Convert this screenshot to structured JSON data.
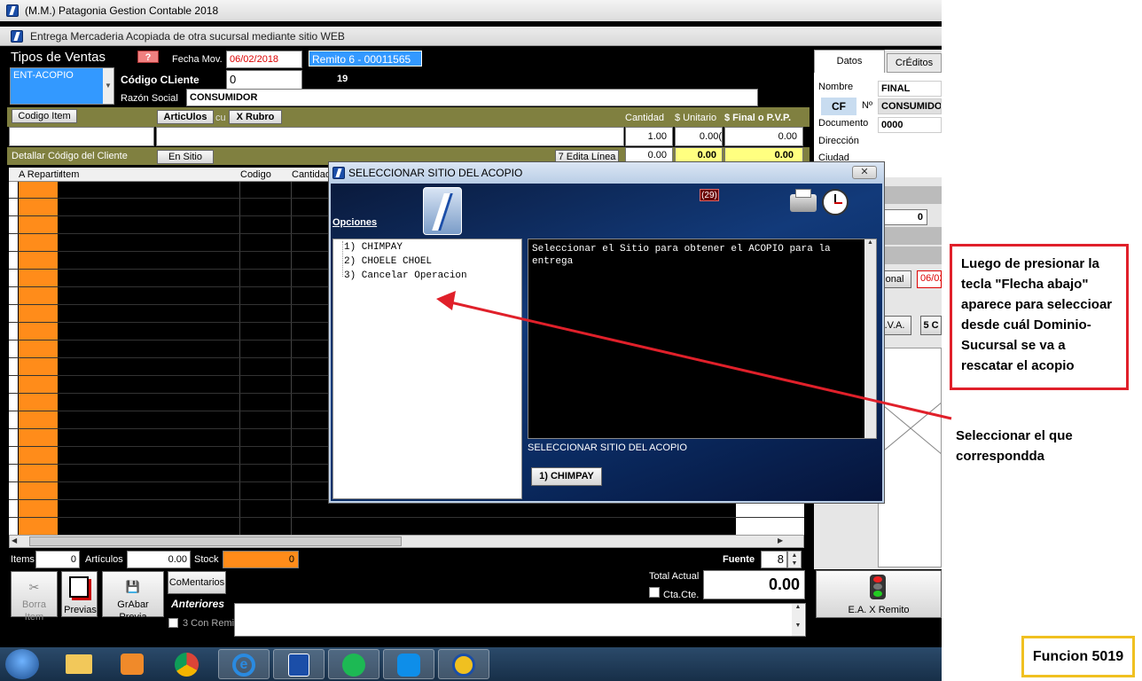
{
  "window": {
    "title": "(M.M.) Patagonia Gestion Contable 2018",
    "subtitle": "Entrega Mercaderia Acopiada de otra sucursal mediante sitio WEB"
  },
  "header": {
    "tipos_ventas_label": "Tipos de Ventas",
    "tipos_ventas_selected": "ENT-ACOPIO",
    "help_button": "?",
    "fecha_label": "Fecha Mov.",
    "fecha_value": "06/02/2018",
    "remito_label": "Remito   6 - 00011565",
    "codigo_cliente_label": "Código CLiente",
    "codigo_cliente_value": "0",
    "codigo_extra": "19",
    "razon_social_label": "Razón Social",
    "razon_social_value": "CONSUMIDOR"
  },
  "toolbar": {
    "codigo_item_button": "Codigo Item",
    "articulos_button": "ArticUlos",
    "cu_label": "cu",
    "rubro_button": "X Rubro",
    "cantidad_label": "Cantidad",
    "unitario_label": "$ Unitario",
    "final_label": "$ Final o P.V.P.",
    "cantidad_value": "1.00",
    "unitario_value": "0.00(",
    "final_value": "0.00",
    "detallar_label": "Detallar Código del Cliente",
    "sitio_web_button": "En Sitio Web",
    "edita_linea_button": "7 Edita Línea",
    "row2_val1": "0.00",
    "row2_val2": "0.00",
    "row2_val3": "0.00"
  },
  "grid": {
    "headers": [
      "A Repartir",
      "Item",
      "Codigo",
      "Cantidad"
    ]
  },
  "right_panel": {
    "tabs": [
      "Datos",
      "CrÉditos"
    ],
    "nombre_label": "Nombre",
    "nombre_value": "FINAL",
    "cf_label": "CF",
    "n_label": "Nº",
    "consumidor_value": "CONSUMIDOR",
    "documento_label": "Documento",
    "documento_value": "0000",
    "direccion_label": "Dirección",
    "ciudad_label": "Ciudad",
    "zero_value": "0",
    "onal_label": "onal",
    "date_value": "06/02",
    "iva_label": ".V.A.",
    "five_label": "5 C"
  },
  "footer": {
    "items_label": "Items",
    "items_value": "0",
    "articulos_label": "Artículos",
    "articulos_value": "0.00",
    "stock_label": "Stock",
    "stock_value": "0",
    "fuente_label": "Fuente",
    "fuente_value": "8",
    "borra_item": "Borra Item",
    "previas": "Previas",
    "grabar_previa": "GrAbar Previa",
    "comentarios": "CoMentarios",
    "anteriores": "Anteriores",
    "con_remito": "3 Con Remito",
    "total_actual_label": "Total Actual",
    "total_actual_value": "0.00",
    "cta_cte": "Cta.Cte.",
    "ea_remito": "E.A. X Remito"
  },
  "dialog": {
    "title": "SELECCIONAR SITIO DEL ACOPIO",
    "counter": "(29)",
    "opciones_label": "Opciones",
    "options": [
      "1) CHIMPAY",
      "2) CHOELE CHOEL",
      "3) Cancelar Operacion"
    ],
    "message": "Seleccionar el Sitio para obtener el ACOPIO para la entrega",
    "caption": "SELECCIONAR SITIO DEL ACOPIO",
    "selected_button": "1) CHIMPAY"
  },
  "annotations": {
    "note": "Luego de presionar la tecla \"Flecha abajo\" aparece para seleccioar desde cuál Dominio-Sucursal se va a rescatar el acopio",
    "select_hint": "Seleccionar el que correspondda",
    "function_label": "Funcion 5019",
    "arrow_color": "#e0202a",
    "box_color": "#e0202a",
    "func_box_color": "#f0c020"
  }
}
